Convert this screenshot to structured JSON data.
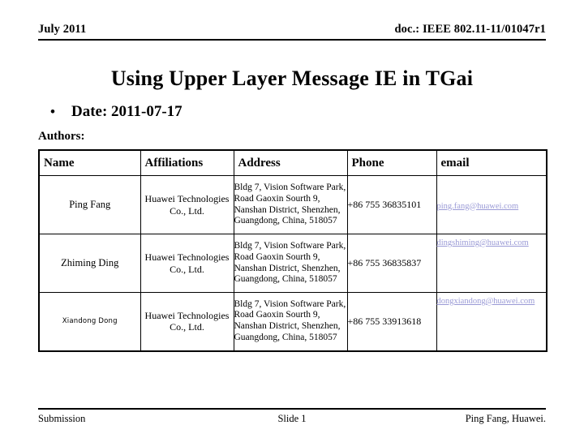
{
  "header": {
    "date": "July 2011",
    "doc_id": "doc.: IEEE 802.11-11/01047r1"
  },
  "title": "Using Upper Layer Message IE in TGai",
  "date_line": {
    "bullet_glyph": "•",
    "text": "Date: 2011-07-17"
  },
  "authors_label": "Authors:",
  "table": {
    "columns": [
      "Name",
      "Affiliations",
      "Address",
      "Phone",
      "email"
    ],
    "rows": [
      {
        "name": "Ping Fang",
        "affiliation": "Huawei Technologies Co., Ltd.",
        "address": "Bldg 7, Vision Software Park, Road Gaoxin Sourth 9, Nanshan District, Shenzhen, Guangdong, China, 518057",
        "phone": "+86 755 36835101",
        "email": "ping.fang@huawei.com"
      },
      {
        "name": "Zhiming Ding",
        "affiliation": "Huawei Technologies Co., Ltd.",
        "address": "Bldg 7, Vision Software Park, Road Gaoxin Sourth 9, Nanshan District, Shenzhen, Guangdong, China, 518057",
        "phone": "+86 755 36835837",
        "email": "dingshiming@huawei.com"
      },
      {
        "name": "Xiandong Dong",
        "affiliation": "Huawei Technologies Co., Ltd.",
        "address": "Bldg 7, Vision Software Park, Road Gaoxin Sourth 9, Nanshan District, Shenzhen, Guangdong, China, 518057",
        "phone": "+86 755 33913618",
        "email": "dongxiandong@huawei.com"
      }
    ]
  },
  "footer": {
    "left": "Submission",
    "center": "Slide 1",
    "right": "Ping Fang, Huawei."
  },
  "colors": {
    "text": "#000000",
    "background": "#ffffff",
    "link": "#9a9ad6",
    "rule": "#000000"
  }
}
